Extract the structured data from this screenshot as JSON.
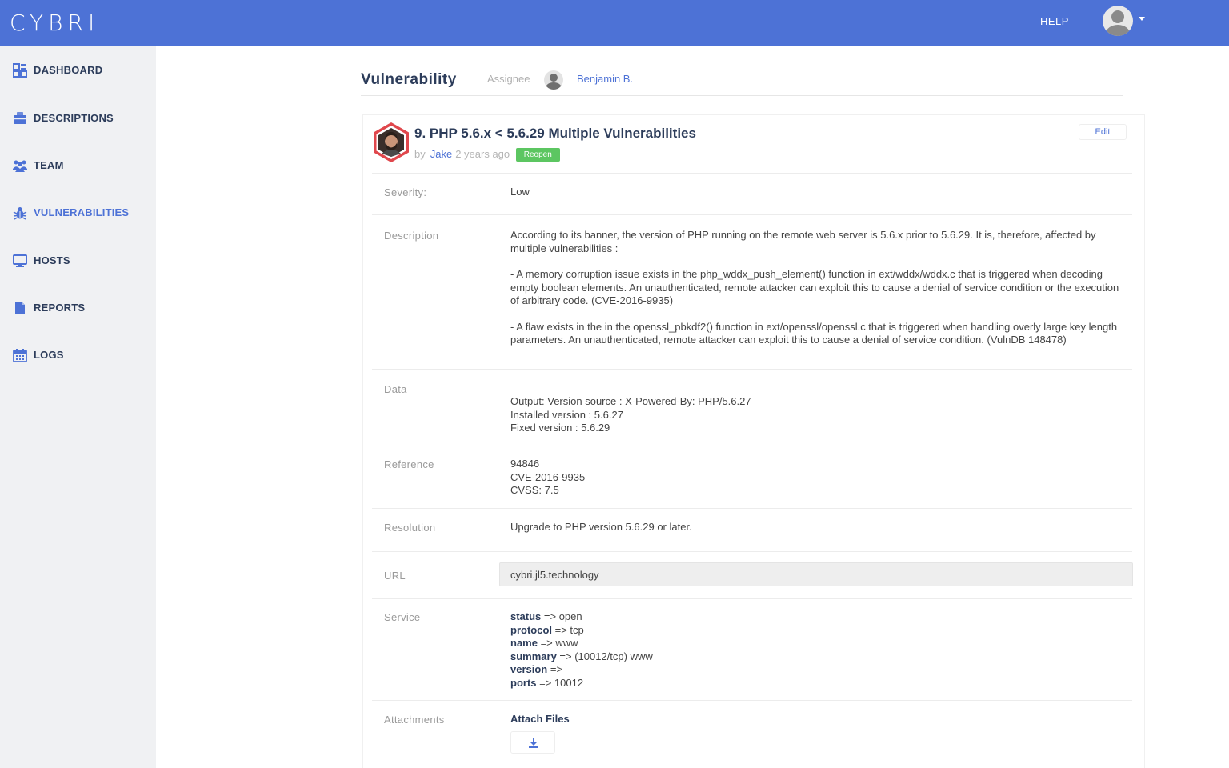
{
  "app": {
    "logo": "CYBRI",
    "help": "HELP"
  },
  "sidebar": {
    "items": [
      {
        "label": "DASHBOARD",
        "icon": "dashboard-icon"
      },
      {
        "label": "DESCRIPTIONS",
        "icon": "briefcase-icon"
      },
      {
        "label": "TEAM",
        "icon": "team-icon"
      },
      {
        "label": "VULNERABILITIES",
        "icon": "bug-icon",
        "active": true
      },
      {
        "label": "HOSTS",
        "icon": "monitor-icon"
      },
      {
        "label": "REPORTS",
        "icon": "document-icon"
      },
      {
        "label": "LOGS",
        "icon": "calendar-icon"
      }
    ]
  },
  "header": {
    "title": "Vulnerability",
    "assignee_label": "Assignee",
    "assignee_name": "Benjamin B."
  },
  "vuln": {
    "title": "9. PHP 5.6.x < 5.6.29 Multiple Vulnerabilities",
    "by": "by",
    "author": "Jake",
    "time": "2 years ago",
    "status_badge": "Reopen",
    "edit": "Edit"
  },
  "fields": {
    "severity": {
      "label": "Severity:",
      "value": "Low"
    },
    "description": {
      "label": "Description",
      "paragraphs": [
        "According to its banner, the version of PHP running on the remote web server is 5.6.x prior to 5.6.29. It is, therefore, affected by multiple vulnerabilities :",
        "- A memory corruption issue exists in the php_wddx_push_element() function in ext/wddx/wddx.c that is triggered when decoding empty boolean elements. An unauthenticated, remote attacker can exploit this to cause a denial of service condition or the execution of arbitrary code. (CVE-2016-9935)",
        "- A flaw exists in the in the openssl_pbkdf2() function in ext/openssl/openssl.c that is triggered when handling overly large key length parameters. An unauthenticated, remote attacker can exploit this to cause a denial of service condition. (VulnDB 148478)"
      ]
    },
    "data": {
      "label": "Data",
      "lines": [
        "Output: Version source : X-Powered-By: PHP/5.6.27",
        "Installed version : 5.6.27",
        "Fixed version : 5.6.29"
      ]
    },
    "reference": {
      "label": "Reference",
      "lines": [
        "94846",
        "CVE-2016-9935",
        "CVSS: 7.5"
      ]
    },
    "resolution": {
      "label": "Resolution",
      "value": "Upgrade to PHP version 5.6.29 or later."
    },
    "url": {
      "label": "URL",
      "value": "cybri.jl5.technology"
    },
    "service": {
      "label": "Service",
      "entries": [
        {
          "key": "status",
          "value": " => open"
        },
        {
          "key": "protocol",
          "value": " => tcp"
        },
        {
          "key": "name",
          "value": " => www"
        },
        {
          "key": "summary",
          "value": " => (10012/tcp) www"
        },
        {
          "key": "version",
          "value": " =>"
        },
        {
          "key": "ports",
          "value": " => 10012"
        }
      ]
    },
    "attachments": {
      "label": "Attachments",
      "title": "Attach Files"
    }
  },
  "colors": {
    "topbar": "#4d72d6",
    "accent": "#4d72d6",
    "badge": "#5cc661",
    "sidebar": "#f0f1f3",
    "avatar_ring": "#e0474c"
  }
}
